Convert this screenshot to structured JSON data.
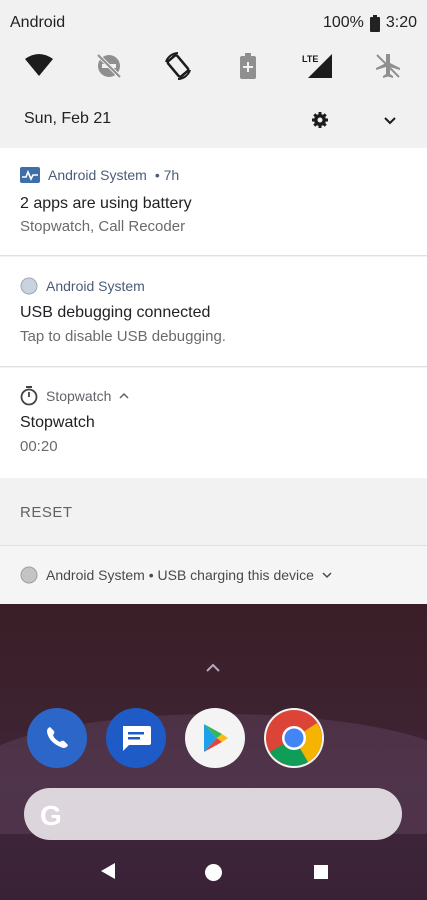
{
  "status_bar": {
    "carrier": "Android",
    "battery": "100%",
    "time": "3:20"
  },
  "quick_settings": {
    "tiles": [
      "wifi-icon",
      "dnd-off-icon",
      "auto-rotate-icon",
      "battery-saver-icon",
      "lte-signal-icon",
      "airplane-mode-icon"
    ],
    "lte_label": "LTE",
    "date": "Sun, Feb 21"
  },
  "notifications": [
    {
      "app": "Android System",
      "meta": "• 7h",
      "title": "2 apps are using battery",
      "text": "Stopwatch, Call Recoder"
    },
    {
      "app": "Android System",
      "title": "USB debugging connected",
      "text": "Tap to disable USB debugging."
    },
    {
      "app": "Stopwatch",
      "title": "Stopwatch",
      "text": "00:20",
      "action": "RESET"
    }
  ],
  "charging": {
    "text": "Android System • USB charging this device"
  },
  "home": {
    "dock": [
      "phone-icon",
      "messages-icon",
      "play-store-icon",
      "chrome-icon"
    ],
    "search_logo": "G"
  }
}
